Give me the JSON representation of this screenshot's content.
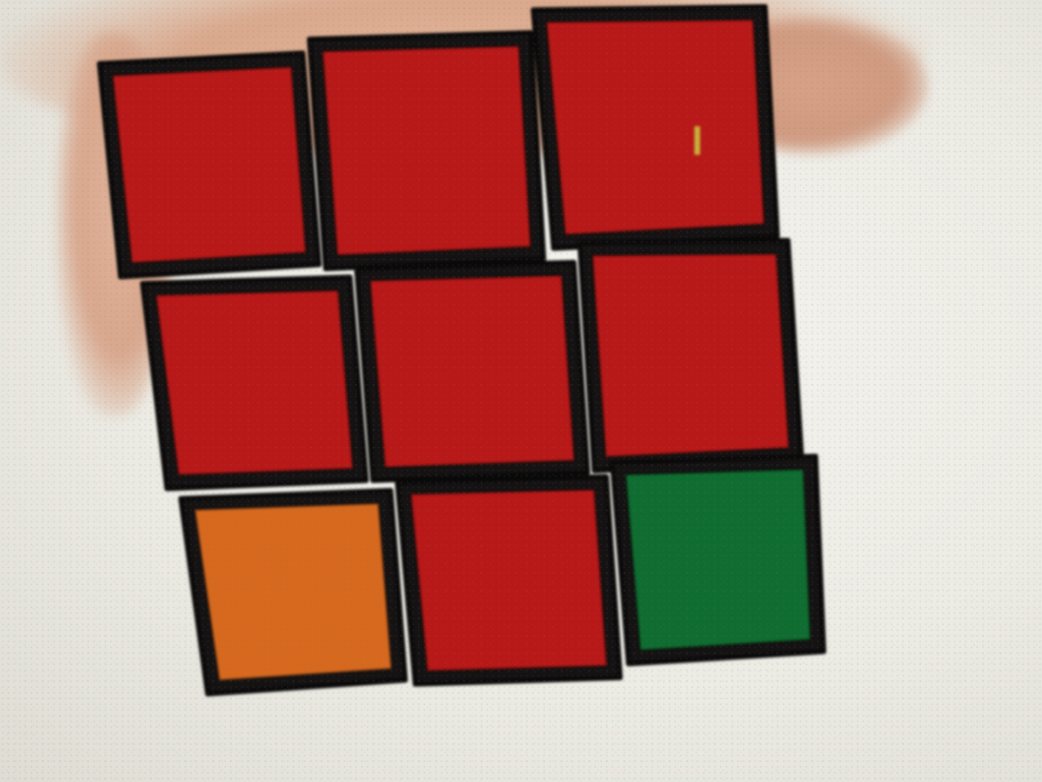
{
  "scene": {
    "subject": "rubiks-cube-face",
    "background_color": "#ecebe4"
  },
  "cube_face": {
    "rows": 3,
    "cols": 3,
    "body_color": "#141212",
    "stickers": [
      [
        "red",
        "red",
        "red"
      ],
      [
        "red",
        "red",
        "red"
      ],
      [
        "orange",
        "red",
        "green"
      ]
    ]
  },
  "colors": {
    "red": "#b81818",
    "orange": "#d7691f",
    "green": "#0f6d31",
    "skin": "#d9a88c"
  }
}
